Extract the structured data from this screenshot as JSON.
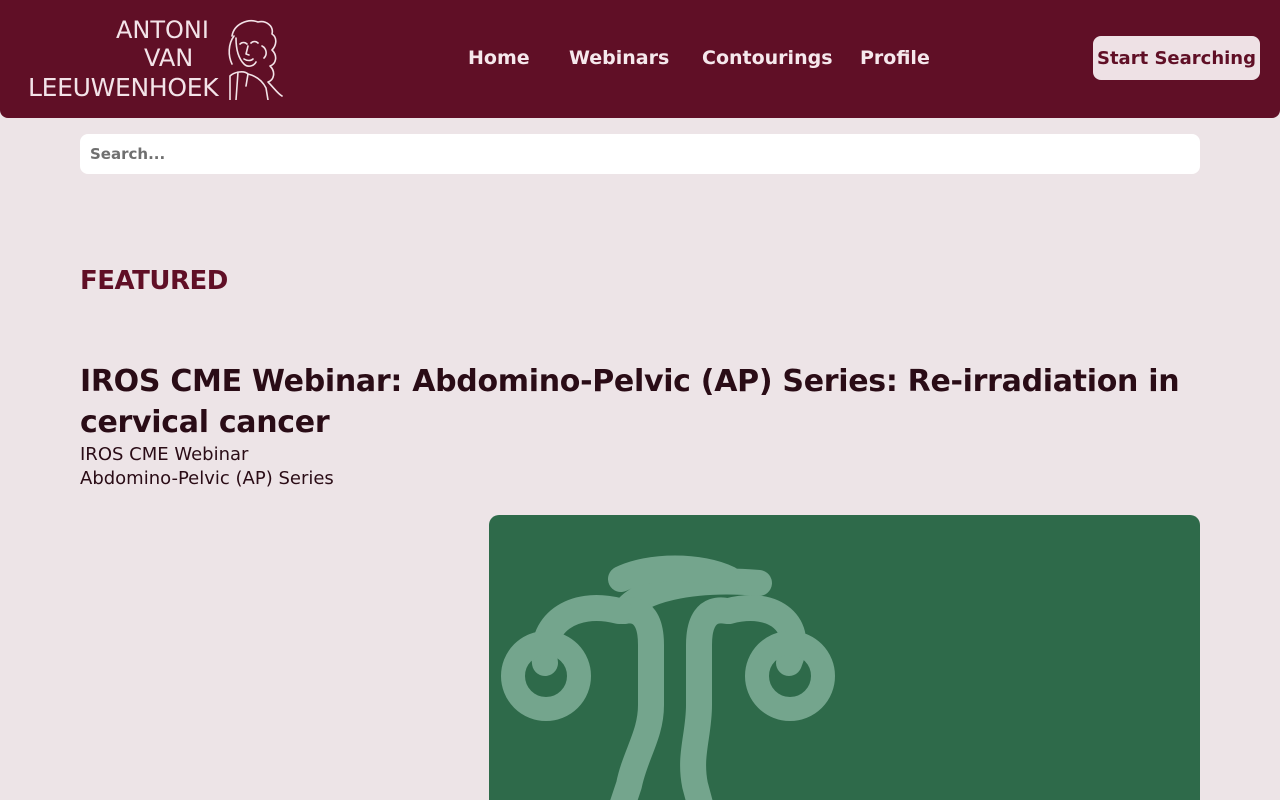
{
  "header": {
    "logo": {
      "line1": "ANTONI",
      "line2": "VAN",
      "line3": "LEEUWENHOEK",
      "portrait_icon": "leeuwenhoek-portrait-icon"
    },
    "nav": [
      {
        "label": "Home"
      },
      {
        "label": "Webinars"
      },
      {
        "label": "Contourings"
      },
      {
        "label": "Profile"
      }
    ],
    "cta_label": "Start Searching"
  },
  "search": {
    "placeholder": "Search...",
    "value": ""
  },
  "featured": {
    "heading": "FEATURED",
    "item": {
      "title": "IROS CME Webinar: Abdomino-Pelvic (AP) Series: Re-irradiation in cervical cancer",
      "category": "IROS CME Webinar",
      "series": "Abdomino-Pelvic (AP) Series",
      "thumbnail_icon": "uterus-icon"
    }
  },
  "colors": {
    "brand": "#600f26",
    "page_background": "#ede4e7",
    "card_green": "#2e6a4a",
    "icon_green": "#74a58d"
  }
}
